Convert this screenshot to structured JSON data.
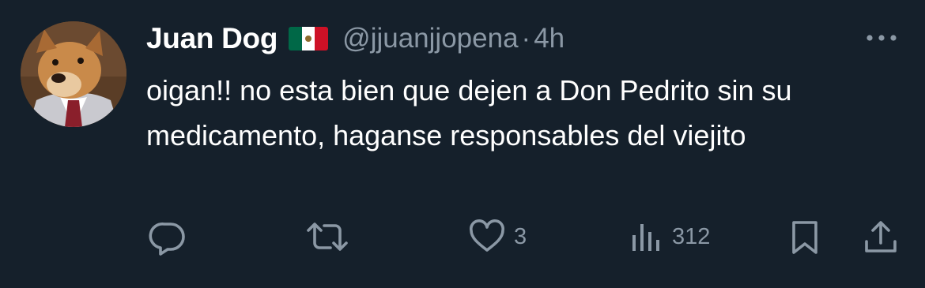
{
  "author": {
    "display_name": "Juan Dog",
    "flag_icon": "mexico-flag-icon",
    "handle": "@jjuanjjopena",
    "separator": "·",
    "time": "4h"
  },
  "tweet": {
    "text": "oigan!! no esta bien que dejen a Don Pedrito sin su medicamento, haganse responsables del viejito"
  },
  "actions": {
    "reply": {
      "icon": "reply-icon",
      "count": ""
    },
    "retweet": {
      "icon": "retweet-icon",
      "count": ""
    },
    "like": {
      "icon": "heart-icon",
      "count": "3"
    },
    "views": {
      "icon": "views-icon",
      "count": "312"
    },
    "bookmark": {
      "icon": "bookmark-icon"
    },
    "share": {
      "icon": "share-icon"
    }
  },
  "colors": {
    "background": "#15202b",
    "text": "#ffffff",
    "secondary": "#8b98a5"
  }
}
